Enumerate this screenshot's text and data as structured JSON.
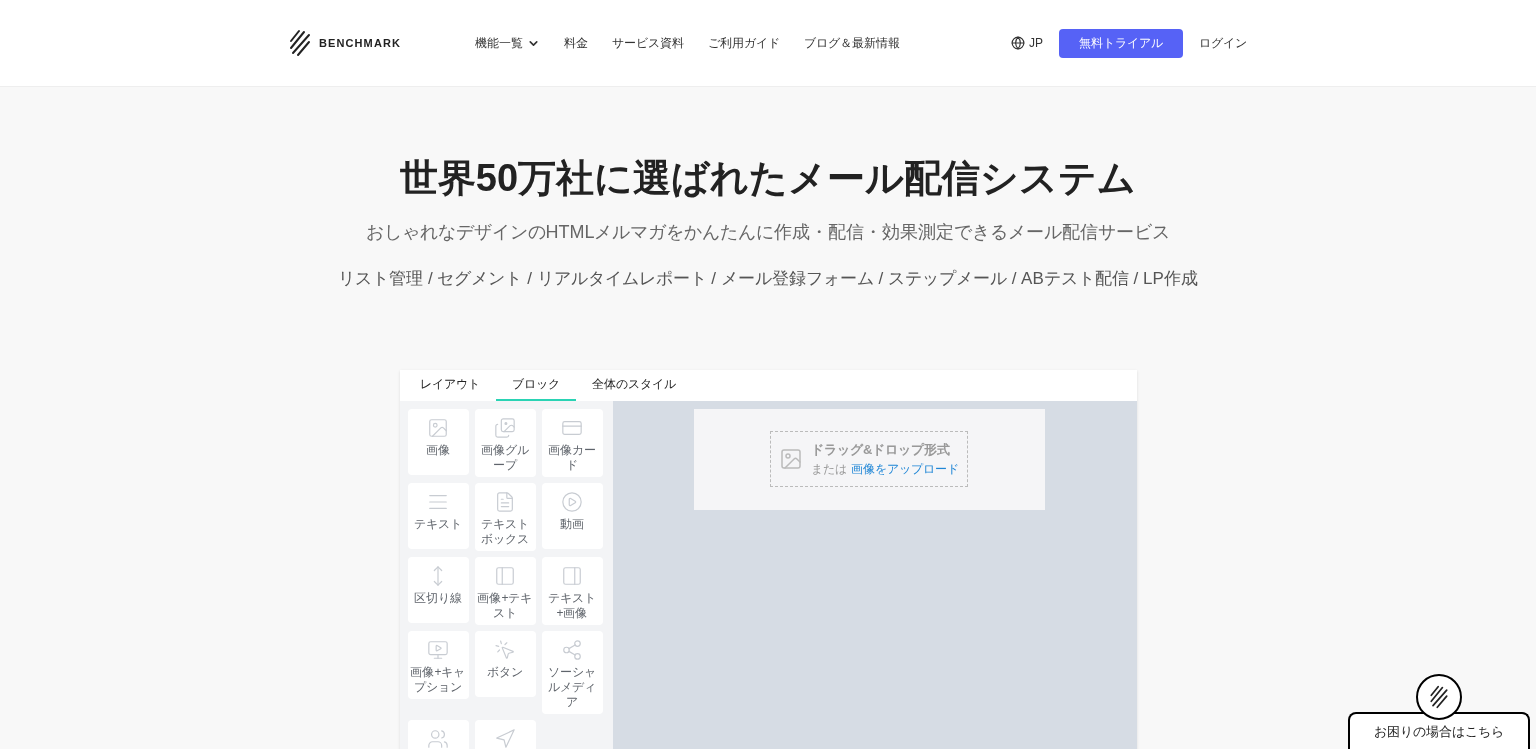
{
  "header": {
    "logo_text": "BENCHMARK",
    "nav": [
      {
        "label": "機能一覧",
        "has_dropdown": true
      },
      {
        "label": "料金",
        "has_dropdown": false
      },
      {
        "label": "サービス資料",
        "has_dropdown": false
      },
      {
        "label": "ご利用ガイド",
        "has_dropdown": false
      },
      {
        "label": "ブログ＆最新情報",
        "has_dropdown": false
      }
    ],
    "language": "JP",
    "trial_button": "無料トライアル",
    "login": "ログイン"
  },
  "hero": {
    "title": "世界50万社に選ばれたメール配信システム",
    "subtitle": "おしゃれなデザインのHTMLメルマガをかんたんに作成・配信・効果測定できるメール配信サービス",
    "features": "リスト管理 / セグメント / リアルタイムレポート / メール登録フォーム / ステップメール / ABテスト配信 / LP作成"
  },
  "editor": {
    "tabs": [
      {
        "label": "レイアウト",
        "selected": false
      },
      {
        "label": "ブロック",
        "selected": true
      },
      {
        "label": "全体のスタイル",
        "selected": false
      }
    ],
    "blocks": [
      {
        "kind": "image",
        "label": "画像"
      },
      {
        "kind": "image-group",
        "label": "画像グループ"
      },
      {
        "kind": "image-card",
        "label": "画像カード"
      },
      {
        "kind": "text",
        "label": "テキスト"
      },
      {
        "kind": "text-box",
        "label": "テキストボックス"
      },
      {
        "kind": "video",
        "label": "動画"
      },
      {
        "kind": "divider",
        "label": "区切り線"
      },
      {
        "kind": "image-text",
        "label": "画像+テキスト"
      },
      {
        "kind": "text-image",
        "label": "テキスト+画像"
      },
      {
        "kind": "image-caption",
        "label": "画像+キャプション"
      },
      {
        "kind": "button",
        "label": "ボタン"
      },
      {
        "kind": "social",
        "label": "ソーシャルメディア"
      },
      {
        "kind": "social-follow"
      },
      {
        "kind": "navigation"
      }
    ],
    "drop_zone": {
      "title": "ドラッグ&ドロップ形式",
      "prefix": "または",
      "link": "画像をアップロード"
    }
  },
  "help_button": "お困りの場合はこちら"
}
